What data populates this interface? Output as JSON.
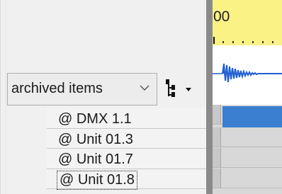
{
  "filter": {
    "selected": "archived items",
    "chevron_icon": "chevron-down-icon",
    "tree_icon": "tree-view-icon"
  },
  "items": [
    {
      "label": "@ DMX 1.1"
    },
    {
      "label": "@ Unit 01.3"
    },
    {
      "label": "@ Unit 01.7"
    },
    {
      "label": "@ Unit 01.8"
    }
  ],
  "timeline": {
    "ruler_text": "00",
    "ruler_color": "#fbf286",
    "waveform_color": "#1f5fd0",
    "block_color": "#3a7fd0"
  }
}
